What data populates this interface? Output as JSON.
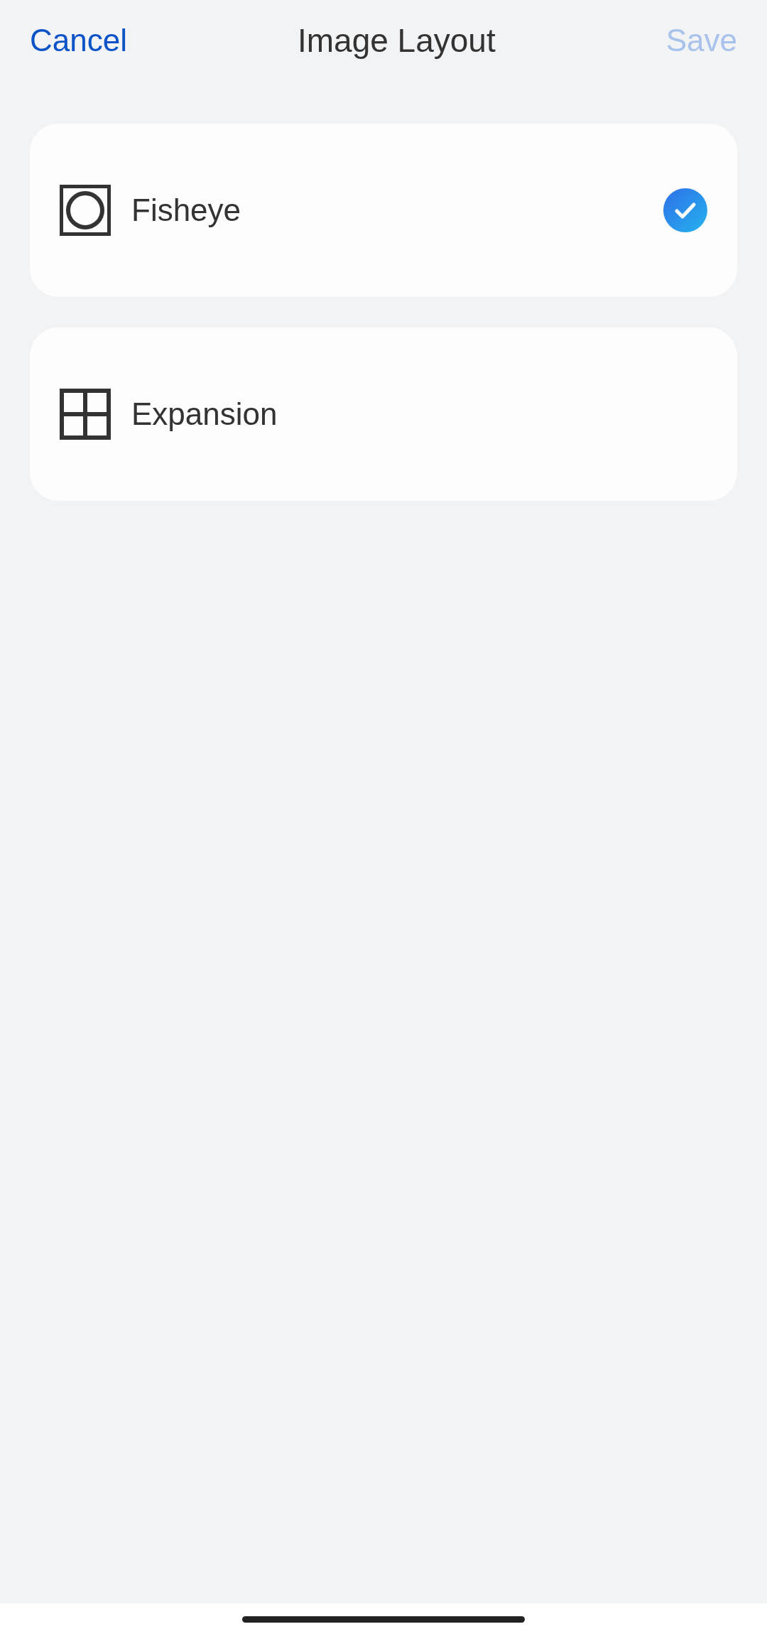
{
  "header": {
    "cancel": "Cancel",
    "title": "Image Layout",
    "save": {
      "label": "Save",
      "disabled": true
    }
  },
  "options": [
    {
      "kind": "fisheye",
      "label": "Fisheye",
      "selected": true
    },
    {
      "kind": "grid",
      "label": "Expansion",
      "selected": false
    }
  ]
}
